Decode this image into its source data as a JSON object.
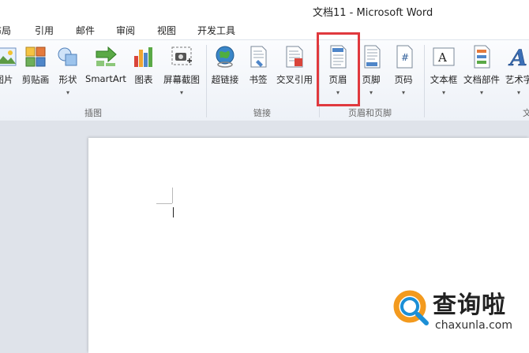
{
  "window": {
    "title": "文档11  -  Microsoft Word"
  },
  "tabs": [
    {
      "label": "布局"
    },
    {
      "label": "引用"
    },
    {
      "label": "邮件"
    },
    {
      "label": "审阅"
    },
    {
      "label": "视图"
    },
    {
      "label": "开发工具"
    }
  ],
  "ribbon": {
    "illustrations": {
      "group_label": "插图",
      "buttons": [
        {
          "label": "图片",
          "icon": "picture-icon"
        },
        {
          "label": "剪贴画",
          "icon": "clipart-icon"
        },
        {
          "label": "形状",
          "icon": "shapes-icon"
        },
        {
          "label": "SmartArt",
          "icon": "smartart-icon"
        },
        {
          "label": "图表",
          "icon": "chart-icon"
        },
        {
          "label": "屏幕截图",
          "icon": "screenshot-icon"
        }
      ]
    },
    "links": {
      "group_label": "链接",
      "buttons": [
        {
          "label": "超链接",
          "icon": "hyperlink-globe-icon"
        },
        {
          "label": "书签",
          "icon": "bookmark-icon"
        },
        {
          "label": "交叉引用",
          "icon": "cross-reference-icon"
        }
      ]
    },
    "header_footer": {
      "group_label": "页眉和页脚",
      "buttons": [
        {
          "label": "页眉",
          "icon": "header-icon"
        },
        {
          "label": "页脚",
          "icon": "footer-icon"
        },
        {
          "label": "页码",
          "icon": "page-number-icon"
        }
      ]
    },
    "text": {
      "group_label": "文",
      "buttons": [
        {
          "label": "文本框",
          "icon": "textbox-icon"
        },
        {
          "label": "文档部件",
          "icon": "quick-parts-icon"
        },
        {
          "label": "艺术字",
          "icon": "wordart-icon"
        }
      ]
    }
  },
  "watermark": {
    "name": "查询啦",
    "url": "chaxunla.com"
  }
}
